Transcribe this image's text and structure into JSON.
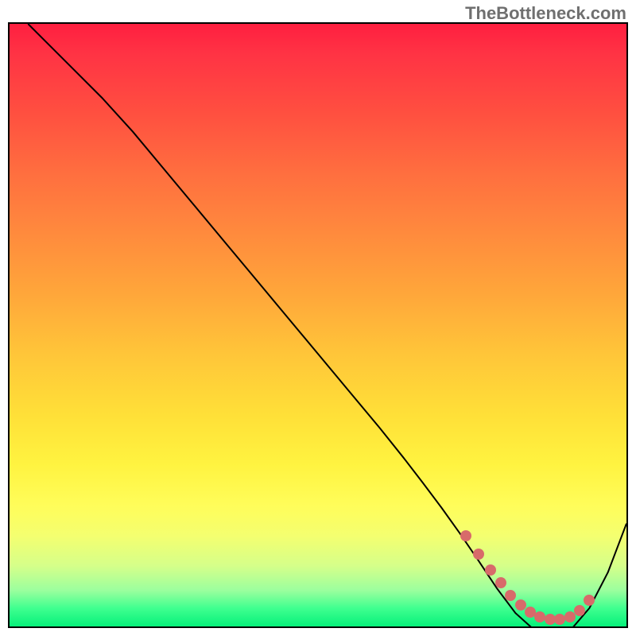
{
  "watermark": "TheBottleneck.com",
  "chart_data": {
    "type": "line",
    "title": "",
    "xlabel": "",
    "ylabel": "",
    "xlim": [
      0,
      100
    ],
    "ylim": [
      0,
      100
    ],
    "grid": false,
    "series": [
      {
        "name": "curve",
        "color": "#000000",
        "x": [
          3,
          6,
          10,
          15,
          20,
          25,
          30,
          35,
          40,
          45,
          50,
          55,
          60,
          64,
          67,
          70,
          73,
          76,
          79,
          82,
          85,
          88,
          91,
          94,
          97,
          100
        ],
        "y": [
          100,
          97,
          93,
          88,
          82.5,
          76.5,
          70.5,
          64.5,
          58.5,
          52.5,
          46.5,
          40.5,
          34.5,
          29.5,
          25.6,
          21.6,
          17.4,
          13.0,
          8.5,
          4.5,
          1.8,
          0.6,
          1.8,
          5.3,
          11.1,
          19.0
        ]
      }
    ],
    "highlight_dots": {
      "color": "#d86a6a",
      "x": [
        74.0,
        76.0,
        78.0,
        79.6,
        81.2,
        82.8,
        84.4,
        86.0,
        87.6,
        89.2,
        90.8,
        92.4,
        94.0
      ],
      "y": [
        15.0,
        12.0,
        9.4,
        7.2,
        5.2,
        3.6,
        2.4,
        1.6,
        1.2,
        1.2,
        1.6,
        2.6,
        4.4
      ]
    },
    "background_gradient": {
      "top_color": "#ff1f40",
      "bottom_color": "#06f07a",
      "orientation": "vertical"
    }
  }
}
